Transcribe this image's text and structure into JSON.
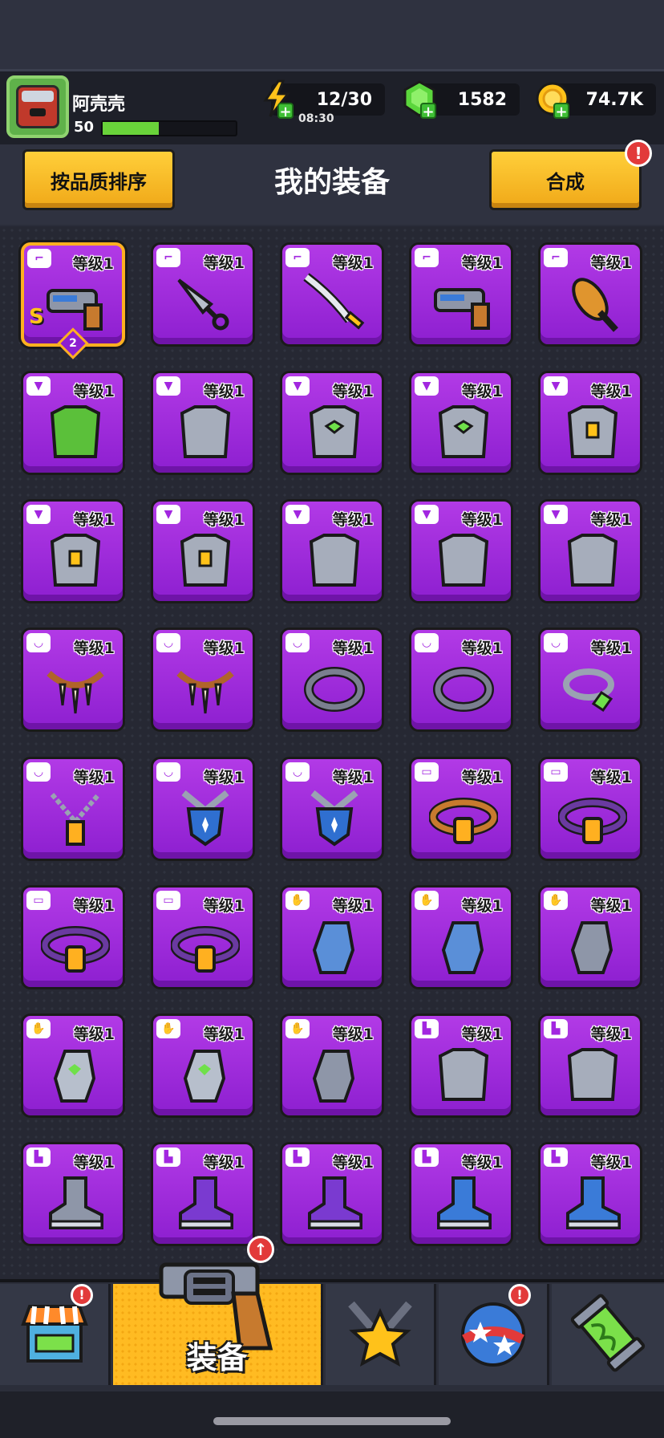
{
  "player": {
    "name": "阿壳壳",
    "level": "50",
    "xp_fraction": 0.42
  },
  "resources": {
    "energy": "12/30",
    "energy_timer": "08:30",
    "gems": "1582",
    "coins": "74.7K"
  },
  "header": {
    "sort_button": "按品质排序",
    "title": "我的装备",
    "merge_button": "合成",
    "merge_alert": "!"
  },
  "equipment": {
    "level_label": "等级1",
    "featured_rank": "S",
    "featured_stars": "2",
    "items": [
      {
        "slot": "weapon",
        "icon": "laser-gun-icon"
      },
      {
        "slot": "weapon",
        "icon": "kunai-icon"
      },
      {
        "slot": "weapon",
        "icon": "katana-icon"
      },
      {
        "slot": "weapon",
        "icon": "shotgun-icon"
      },
      {
        "slot": "weapon",
        "icon": "bat-icon"
      },
      {
        "slot": "armor",
        "icon": "leaf-armor-icon"
      },
      {
        "slot": "armor",
        "icon": "steel-armor-icon"
      },
      {
        "slot": "armor",
        "icon": "gem-armor-icon"
      },
      {
        "slot": "armor",
        "icon": "gem-armor-icon"
      },
      {
        "slot": "armor",
        "icon": "vest-armor-icon"
      },
      {
        "slot": "armor",
        "icon": "vest-armor-icon"
      },
      {
        "slot": "armor",
        "icon": "vest-armor-icon"
      },
      {
        "slot": "armor",
        "icon": "plate-armor-icon"
      },
      {
        "slot": "armor",
        "icon": "plate-armor-icon"
      },
      {
        "slot": "armor",
        "icon": "plate-armor-icon"
      },
      {
        "slot": "necklace",
        "icon": "fang-necklace-icon"
      },
      {
        "slot": "necklace",
        "icon": "fang-necklace-icon"
      },
      {
        "slot": "necklace",
        "icon": "spike-collar-icon"
      },
      {
        "slot": "necklace",
        "icon": "spike-collar-icon"
      },
      {
        "slot": "necklace",
        "icon": "gem-ring-necklace-icon"
      },
      {
        "slot": "necklace",
        "icon": "chain-tag-necklace-icon"
      },
      {
        "slot": "necklace",
        "icon": "shield-pendant-icon"
      },
      {
        "slot": "necklace",
        "icon": "shield-pendant-icon"
      },
      {
        "slot": "belt",
        "icon": "knot-belt-icon"
      },
      {
        "slot": "belt",
        "icon": "buckle-belt-icon"
      },
      {
        "slot": "belt",
        "icon": "buckle-belt-icon"
      },
      {
        "slot": "belt",
        "icon": "buckle-belt-icon"
      },
      {
        "slot": "gloves",
        "icon": "claw-glove-icon"
      },
      {
        "slot": "gloves",
        "icon": "claw-glove-icon"
      },
      {
        "slot": "gloves",
        "icon": "mech-glove-icon"
      },
      {
        "slot": "gloves",
        "icon": "power-glove-icon"
      },
      {
        "slot": "gloves",
        "icon": "power-glove-icon"
      },
      {
        "slot": "gloves",
        "icon": "iron-gauntlet-icon"
      },
      {
        "slot": "boots",
        "icon": "armored-boot-icon"
      },
      {
        "slot": "boots",
        "icon": "armored-boot-icon"
      },
      {
        "slot": "boots",
        "icon": "sneaker-icon"
      },
      {
        "slot": "boots",
        "icon": "purple-sneaker-icon"
      },
      {
        "slot": "boots",
        "icon": "purple-sneaker-icon"
      },
      {
        "slot": "boots",
        "icon": "jet-boot-icon"
      },
      {
        "slot": "boots",
        "icon": "jet-boot-icon"
      }
    ]
  },
  "nav": {
    "active_label": "装备",
    "tabs": [
      "shop",
      "equipment",
      "battle",
      "talents",
      "gene"
    ]
  },
  "colors": {
    "card_purple": "#a42ce0",
    "accent_yellow": "#ffc22a",
    "alert_red": "#e23a3a"
  }
}
